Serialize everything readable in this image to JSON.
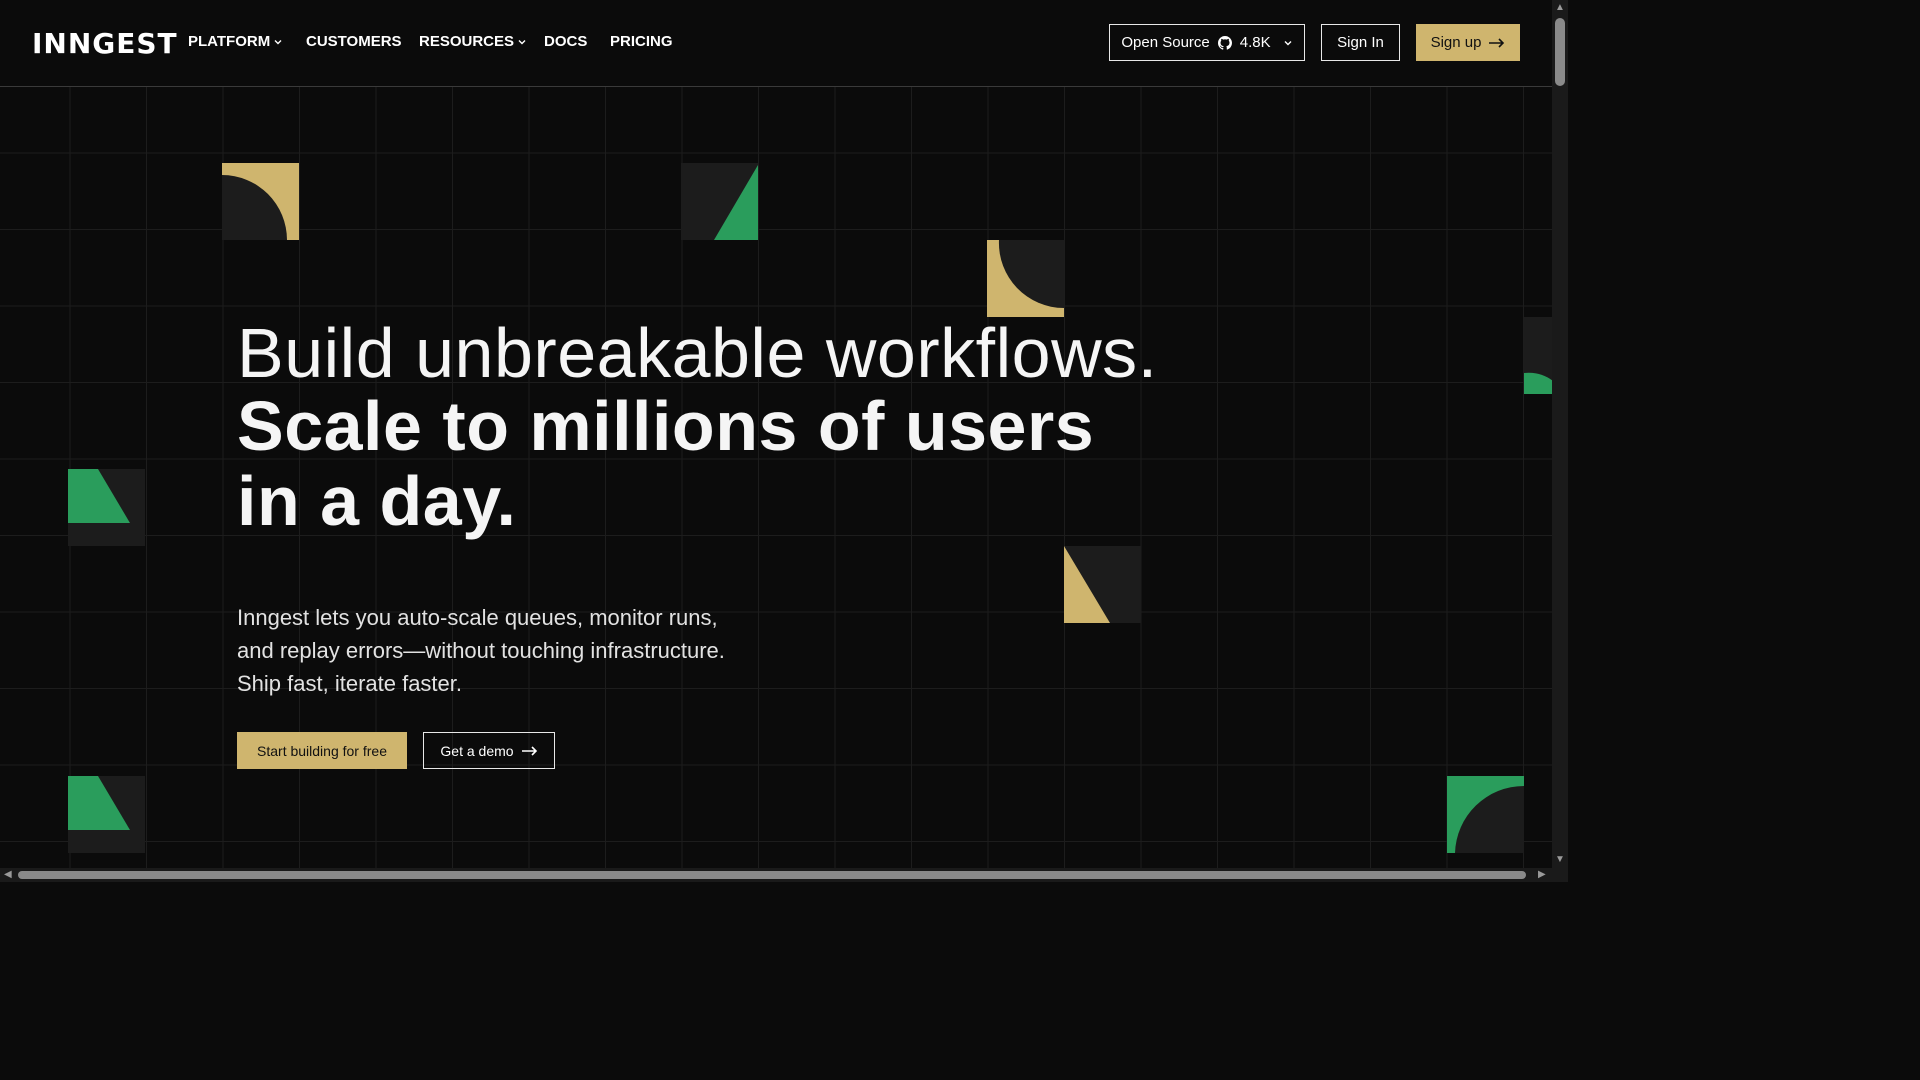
{
  "nav": {
    "logo": "INNGEST",
    "links": [
      {
        "label": "PLATFORM",
        "dropdown": true
      },
      {
        "label": "CUSTOMERS",
        "dropdown": false
      },
      {
        "label": "RESOURCES",
        "dropdown": true
      },
      {
        "label": "DOCS",
        "dropdown": false
      },
      {
        "label": "PRICING",
        "dropdown": false
      }
    ],
    "open_source": {
      "label": "Open Source",
      "icon": "github-icon",
      "stars": "4.8K"
    },
    "sign_in": "Sign In",
    "sign_up": "Sign up"
  },
  "hero": {
    "headline_line1": "Build unbreakable workflows.",
    "headline_line2": "Scale to millions of users",
    "headline_line3": "in a day.",
    "subtitle_line1": "Inngest lets you auto-scale queues, monitor runs,",
    "subtitle_line2": "and replay errors—without touching infrastructure.",
    "subtitle_line3": "Ship fast, iterate faster.",
    "cta_primary": "Start building for free",
    "cta_secondary": "Get a demo"
  },
  "colors": {
    "background": "#0b0b0b",
    "gold": "#cfb56e",
    "green": "#2a9d5c",
    "tile_dark": "#1c1c1c"
  }
}
